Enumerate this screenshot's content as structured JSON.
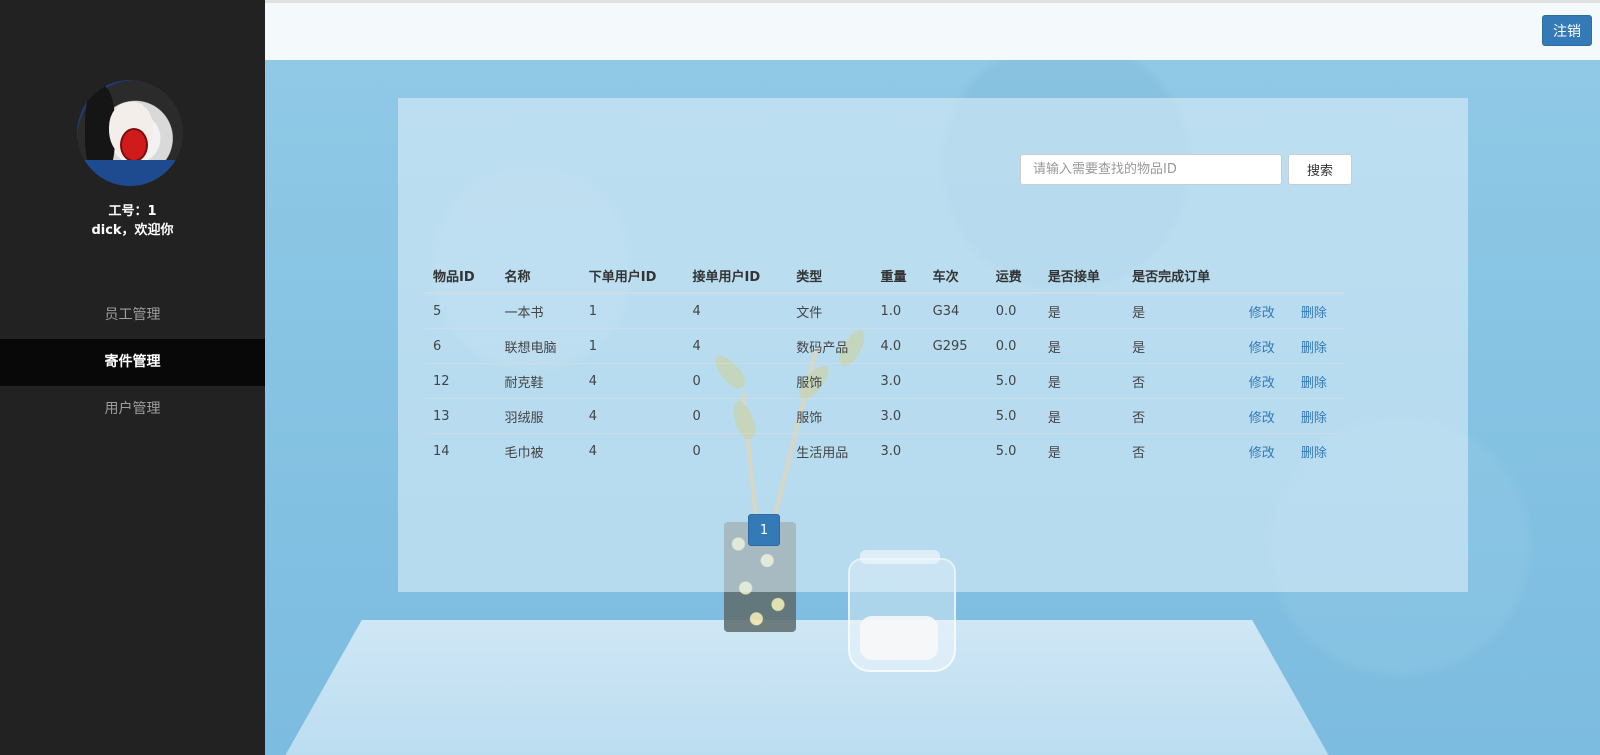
{
  "sidebar": {
    "employee_id": "工号：1",
    "welcome": "dick，欢迎你",
    "nav_items": [
      {
        "label": "员工管理",
        "active": false
      },
      {
        "label": "寄件管理",
        "active": true
      },
      {
        "label": "用户管理",
        "active": false
      }
    ]
  },
  "header": {
    "logout_label": "注销"
  },
  "search": {
    "placeholder": "请输入需要查找的物品ID",
    "value": "",
    "button_label": "搜索"
  },
  "table": {
    "columns": [
      "物品ID",
      "名称",
      "下单用户ID",
      "接单用户ID",
      "类型",
      "重量",
      "车次",
      "运费",
      "是否接单",
      "是否完成订单"
    ],
    "rows": [
      [
        "5",
        "一本书",
        "1",
        "4",
        "文件",
        "1.0",
        "G34",
        "0.0",
        "是",
        "是"
      ],
      [
        "6",
        "联想电脑",
        "1",
        "4",
        "数码产品",
        "4.0",
        "G295",
        "0.0",
        "是",
        "是"
      ],
      [
        "12",
        "耐克鞋",
        "4",
        "0",
        "服饰",
        "3.0",
        "",
        "5.0",
        "是",
        "否"
      ],
      [
        "13",
        "羽绒服",
        "4",
        "0",
        "服饰",
        "3.0",
        "",
        "5.0",
        "是",
        "否"
      ],
      [
        "14",
        "毛巾被",
        "4",
        "0",
        "生活用品",
        "3.0",
        "",
        "5.0",
        "是",
        "否"
      ]
    ],
    "edit_label": "修改",
    "delete_label": "删除"
  },
  "pagination": {
    "current_page": "1"
  },
  "colors": {
    "primary": "#337ab7",
    "sidebar_bg": "#222222",
    "sidebar_active_bg": "#080808"
  }
}
